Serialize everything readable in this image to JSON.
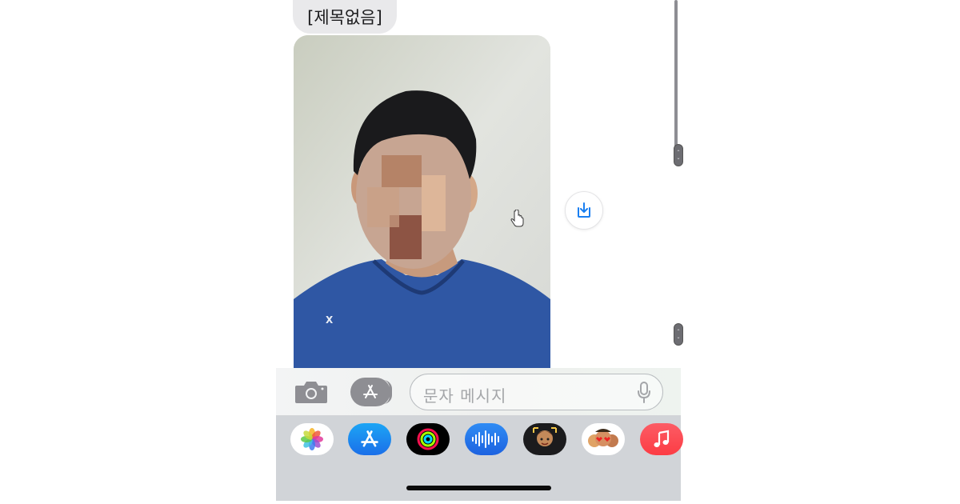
{
  "message": {
    "title_bubble": "[제목없음]"
  },
  "composer": {
    "placeholder": "문자 메시지",
    "camera_icon": "camera-icon",
    "apps_icon": "app-store-icon",
    "mic_icon": "microphone-icon"
  },
  "dock": {
    "apps": [
      {
        "name": "Photos",
        "icon": "photos-icon"
      },
      {
        "name": "App Store",
        "icon": "app-store-icon"
      },
      {
        "name": "Fitness",
        "icon": "activity-rings-icon"
      },
      {
        "name": "Audio Message",
        "icon": "waveform-icon"
      },
      {
        "name": "Memoji",
        "icon": "memoji-icon"
      },
      {
        "name": "Memoji Stickers",
        "icon": "memoji-stickers-icon"
      },
      {
        "name": "Music",
        "icon": "music-icon"
      }
    ]
  },
  "colors": {
    "bubble_gray": "#e9e9eb",
    "dock_bg": "#d1d4d8",
    "accent_blue": "#1a7ff1",
    "music_red": "#fc3c44"
  }
}
